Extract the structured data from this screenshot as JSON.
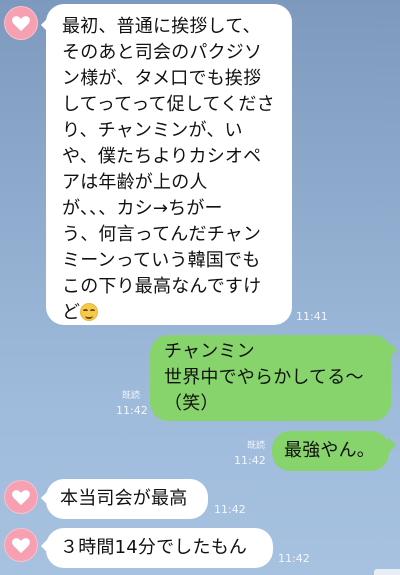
{
  "messages": [
    {
      "side": "in",
      "lines": [
        "最初、普通に挨拶して、",
        "そのあと司会のパクジソ",
        "ン様が、タメ口でも挨拶",
        "してってって促してくださ",
        "り、チャンミンが、い",
        "や、僕たちよりカシオペ",
        "アは年齢が上の人",
        "が、、、カシ→ちがー",
        "う、何言ってんだチャン",
        "ミーンっていう韓国でも",
        "この下り最高なんですけ",
        "ど"
      ],
      "emoji": "relieved-face",
      "time": "11:41"
    },
    {
      "side": "out",
      "lines": [
        "チャンミン",
        "世界中でやらかしてる〜",
        "（笑）"
      ],
      "read": "既読",
      "time": "11:42"
    },
    {
      "side": "out",
      "lines": [
        "最強やん。"
      ],
      "read": "既読",
      "time": "11:42"
    },
    {
      "side": "in",
      "lines": [
        "本当司会が最高"
      ],
      "time": "11:42"
    },
    {
      "side": "in",
      "lines": [
        "３時間14分でしたもん"
      ],
      "time": "11:42"
    }
  ],
  "icons": {
    "avatar": "heart-icon",
    "avatar_color": "#f6a0b2",
    "outgoing_bubble_color": "#86d46b",
    "incoming_bubble_color": "#ffffff"
  }
}
